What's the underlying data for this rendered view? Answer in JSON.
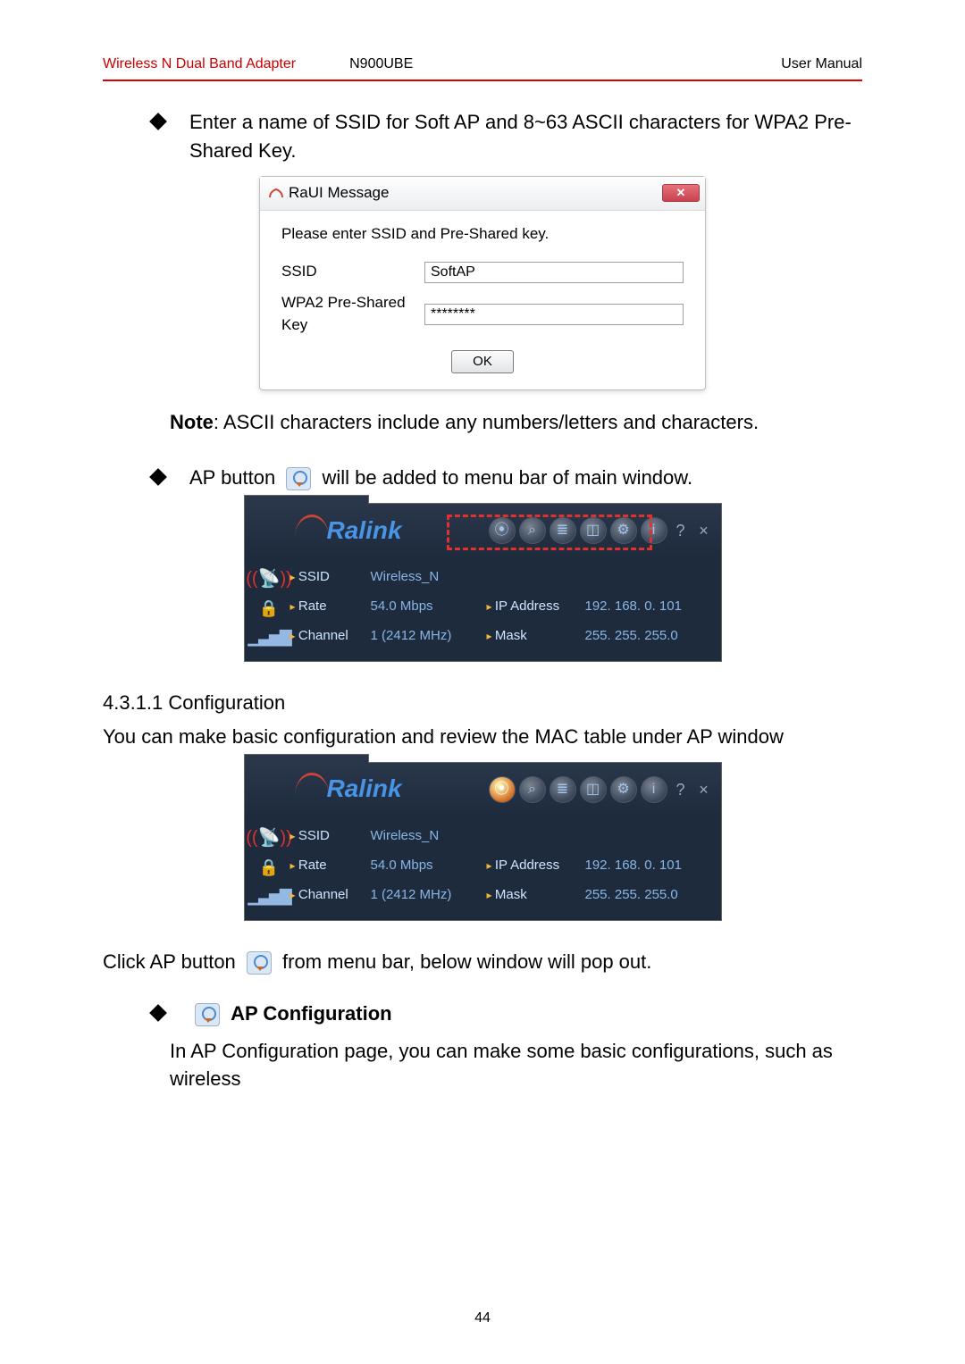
{
  "header": {
    "product": "Wireless N Dual Band Adapter",
    "model": "N900UBE",
    "doc": "User Manual"
  },
  "bullet1": "Enter a name of SSID for Soft AP and 8~63 ASCII characters for WPA2 Pre-Shared Key.",
  "dialog": {
    "title": "RaUI Message",
    "close": "✕",
    "instruction": "Please enter SSID and Pre-Shared key.",
    "ssid_label": "SSID",
    "ssid_value": "SoftAP",
    "key_label": "WPA2 Pre-Shared Key",
    "key_value": "********",
    "ok": "OK"
  },
  "note_prefix": "Note",
  "note_rest": ": ASCII characters include any numbers/letters and characters.",
  "bullet2_a": "AP button",
  "bullet2_b": "will be added to menu bar of main window.",
  "ralink": {
    "brand": "Ralink",
    "menu_icons": [
      "⦿",
      "⌕",
      "≣",
      "◫",
      "⚙",
      "i"
    ],
    "help": "?",
    "close": "×",
    "rows": {
      "ssid_label": "SSID",
      "ssid_val": "Wireless_N",
      "rate_label": "Rate",
      "rate_val": "54.0 Mbps",
      "ip_label": "IP Address",
      "ip_val": "192. 168. 0. 101",
      "ch_label": "Channel",
      "ch_val": "1 (2412 MHz)",
      "mask_label": "Mask",
      "mask_val": "255. 255. 255.0"
    }
  },
  "section": "4.3.1.1  Configuration",
  "section_body": "You can make basic configuration and review the MAC table under AP window",
  "click_a": "Click AP button",
  "click_b": "from menu bar, below window will pop out.",
  "bullet3": "AP Configuration",
  "last_line": "In AP Configuration page, you can make some basic configurations, such as wireless",
  "page_num": "44"
}
